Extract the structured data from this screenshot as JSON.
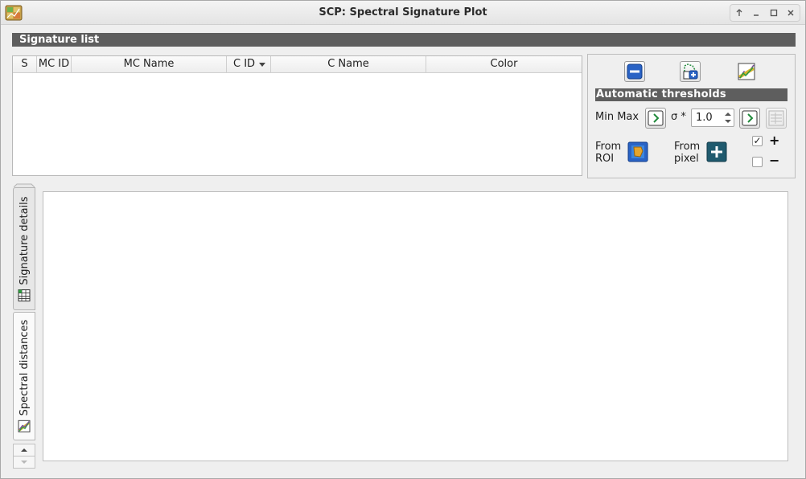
{
  "window": {
    "title": "SCP: Spectral Signature Plot",
    "icon": "scp-plugin-icon",
    "controls": [
      "up-icon",
      "minimize-icon",
      "maximize-icon",
      "close-icon"
    ]
  },
  "signature_list": {
    "header": "Signature list",
    "columns": [
      {
        "label": "S"
      },
      {
        "label": "MC ID"
      },
      {
        "label": "MC Name"
      },
      {
        "label": "C ID",
        "sorted": "descending"
      },
      {
        "label": "C Name"
      },
      {
        "label": "Color"
      }
    ],
    "rows": []
  },
  "tools": {
    "buttons": [
      "remove-signature-icon",
      "add-to-signature-list-icon",
      "plot-icon"
    ],
    "auto_thresholds": {
      "header": "Automatic  thresholds",
      "minmax_label": "Min Max",
      "sigma_label": "σ *",
      "sigma_value": "1.0",
      "from_roi_line1": "From",
      "from_roi_line2": "ROI",
      "from_pixel_line1": "From",
      "from_pixel_line2": "pixel",
      "plus_checked": true,
      "plus_label": "+",
      "minus_checked": false,
      "minus_label": "−"
    }
  },
  "tabs": [
    {
      "label": "Signature details",
      "icon": "signature-table-icon",
      "active": false
    },
    {
      "label": "Spectral distances",
      "icon": "spectral-distance-icon",
      "active": true
    }
  ]
}
